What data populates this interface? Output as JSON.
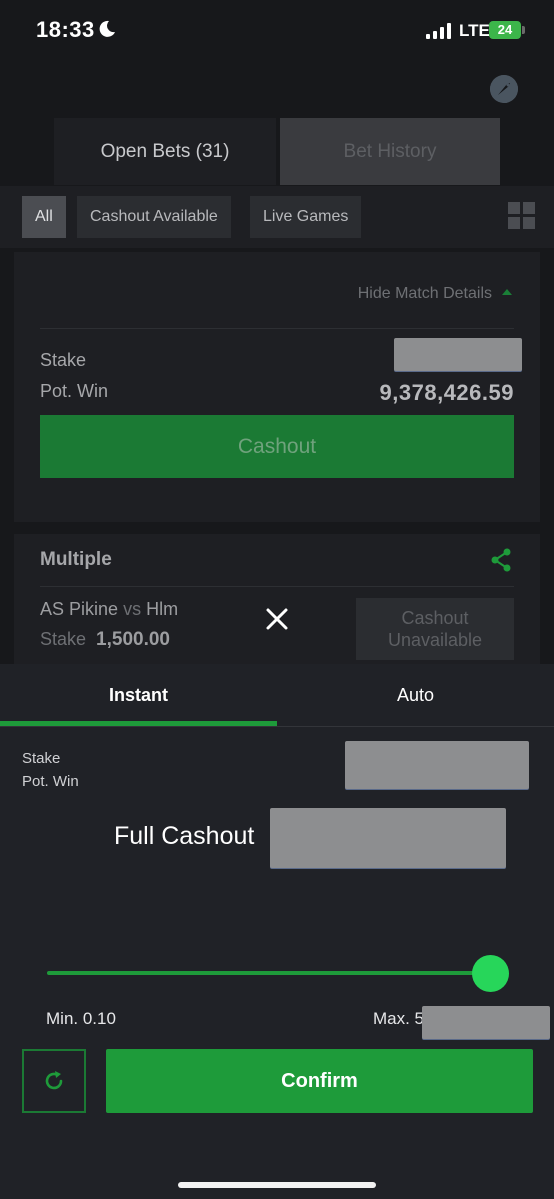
{
  "status_bar": {
    "time": "18:33",
    "network": "LTE",
    "battery": "24"
  },
  "bets_page": {
    "tabs": {
      "open_bets": "Open Bets (31)",
      "bet_history": "Bet History"
    },
    "filters": [
      "All",
      "Cashout Available",
      "Live Games"
    ],
    "card1": {
      "hide_details": "Hide Match Details",
      "stake_label": "Stake",
      "pot_win_label": "Pot. Win",
      "pot_win_value": "9,378,426.59",
      "cashout_label": "Cashout"
    },
    "card2": {
      "title": "Multiple",
      "home_team": "AS Pikine",
      "vs": "vs",
      "away_team": "Hlm",
      "stake_label": "Stake",
      "stake_value": "1,500.00",
      "unavailable_line1": "Cashout",
      "unavailable_line2": "Unavailable"
    }
  },
  "cashout_sheet": {
    "tabs": {
      "instant": "Instant",
      "auto": "Auto"
    },
    "stake_label": "Stake",
    "pot_win_label": "Pot. Win",
    "full_cashout_label": "Full Cashout",
    "slider": {
      "min_label": "Min. 0.10",
      "max_label": "Max. 5",
      "fill_fraction": 1.0
    },
    "confirm_label": "Confirm"
  },
  "colors": {
    "accent_green": "#1e9b3a",
    "thumb_green": "#27d65a",
    "background": "#17181b",
    "sheet": "#202227"
  },
  "icons": [
    "moon-icon",
    "signal-icon",
    "rocket-icon",
    "grid-view-icon",
    "caret-up-icon",
    "share-icon",
    "close-icon",
    "refresh-icon"
  ]
}
